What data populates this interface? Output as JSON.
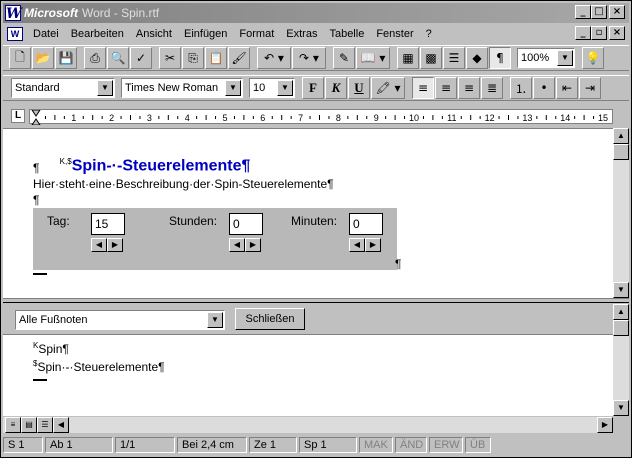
{
  "window": {
    "app_name": "Microsoft",
    "title_rest": "Word - Spin.rtf"
  },
  "menu": {
    "items": [
      "Datei",
      "Bearbeiten",
      "Ansicht",
      "Einfügen",
      "Format",
      "Extras",
      "Tabelle",
      "Fenster",
      "?"
    ]
  },
  "toolbar": {
    "zoom": "100%"
  },
  "format_bar": {
    "style": "Standard",
    "font": "Times New Roman",
    "size": "10",
    "bold": "F",
    "italic": "K",
    "underline": "U"
  },
  "ruler": {
    "ticks": [
      "1",
      "2",
      "3",
      "4",
      "5",
      "6",
      "7",
      "8",
      "9",
      "10",
      "11",
      "12",
      "13",
      "14",
      "15"
    ]
  },
  "document": {
    "heading_marks": "K,$",
    "heading": "Spin-·-Steuerelemente¶",
    "para1": "¶",
    "line2": "Hier·steht·eine·Beschreibung·der·Spin-Steuerelemente¶",
    "para2": "¶",
    "end_mark": "¶",
    "panel": {
      "tag_label": "Tag:",
      "tag_value": "15",
      "stunden_label": "Stunden:",
      "stunden_value": "0",
      "minuten_label": "Minuten:",
      "minuten_value": "0"
    }
  },
  "footnotes": {
    "dropdown": "Alle Fußnoten",
    "close_button": "Schließen",
    "note1_mark": "K",
    "note1_text": "Spin¶",
    "note2_mark": "$",
    "note2_text": "Spin·-·Steuerelemente¶"
  },
  "status": {
    "seite": "S 1",
    "abschnitt": "Ab 1",
    "pages": "1/1",
    "position": "Bei 2,4 cm",
    "zeile": "Ze 1",
    "spalte": "Sp 1",
    "mak": "MAK",
    "and": "ÄND",
    "erw": "ERW",
    "ub": "ÜB"
  }
}
